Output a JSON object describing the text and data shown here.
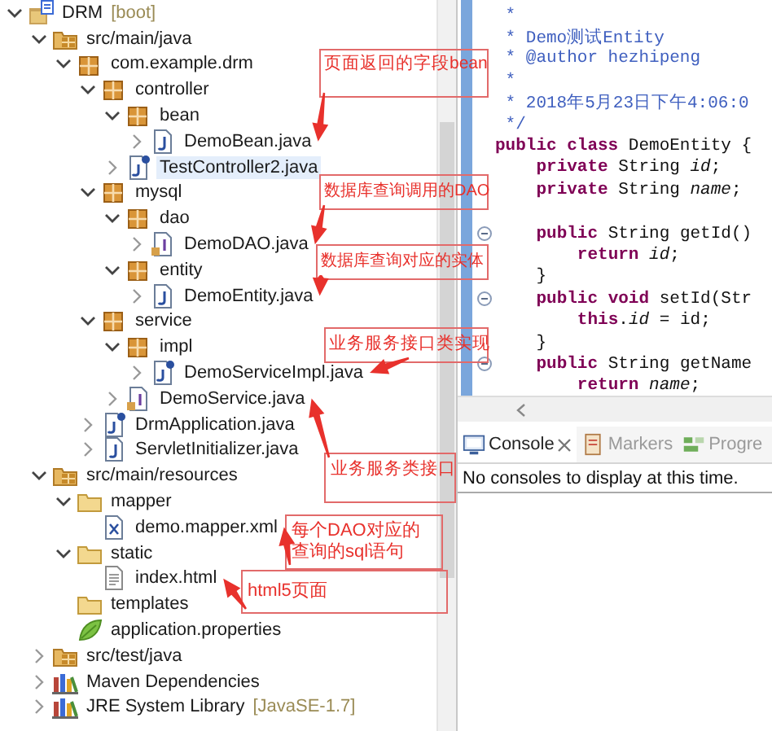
{
  "project_tree": {
    "items": [
      {
        "label": "DRM",
        "decoration": "[boot]",
        "kind": "project",
        "expandable": true,
        "expanded": true,
        "selected": false,
        "children": [
          {
            "label": "src/main/java",
            "kind": "source-folder",
            "expandable": true,
            "expanded": true,
            "selected": false,
            "children": [
              {
                "label": "com.example.drm",
                "kind": "package",
                "expandable": true,
                "expanded": true,
                "selected": false,
                "children": [
                  {
                    "label": "controller",
                    "kind": "package",
                    "expandable": true,
                    "expanded": true,
                    "selected": false,
                    "children": [
                      {
                        "label": "bean",
                        "kind": "package",
                        "expandable": true,
                        "expanded": true,
                        "selected": false,
                        "children": [
                          {
                            "label": "DemoBean.java",
                            "kind": "java",
                            "expandable": true,
                            "expanded": false,
                            "selected": false
                          }
                        ]
                      },
                      {
                        "label": "TestController2.java",
                        "kind": "java-spring",
                        "expandable": true,
                        "expanded": false,
                        "selected": true
                      }
                    ]
                  },
                  {
                    "label": "mysql",
                    "kind": "package",
                    "expandable": true,
                    "expanded": true,
                    "selected": false,
                    "children": [
                      {
                        "label": "dao",
                        "kind": "package",
                        "expandable": true,
                        "expanded": true,
                        "selected": false,
                        "children": [
                          {
                            "label": "DemoDAO.java",
                            "kind": "java-interface",
                            "expandable": true,
                            "expanded": false,
                            "selected": false
                          }
                        ]
                      },
                      {
                        "label": "entity",
                        "kind": "package",
                        "expandable": true,
                        "expanded": true,
                        "selected": false,
                        "children": [
                          {
                            "label": "DemoEntity.java",
                            "kind": "java",
                            "expandable": true,
                            "expanded": false,
                            "selected": false
                          }
                        ]
                      }
                    ]
                  },
                  {
                    "label": "service",
                    "kind": "package",
                    "expandable": true,
                    "expanded": true,
                    "selected": false,
                    "children": [
                      {
                        "label": "impl",
                        "kind": "package",
                        "expandable": true,
                        "expanded": true,
                        "selected": false,
                        "children": [
                          {
                            "label": "DemoServiceImpl.java",
                            "kind": "java-spring",
                            "expandable": true,
                            "expanded": false,
                            "selected": false
                          }
                        ]
                      },
                      {
                        "label": "DemoService.java",
                        "kind": "java-interface",
                        "expandable": true,
                        "expanded": false,
                        "selected": false
                      }
                    ]
                  },
                  {
                    "label": "DrmApplication.java",
                    "kind": "java-spring",
                    "expandable": true,
                    "expanded": false,
                    "selected": false
                  },
                  {
                    "label": "ServletInitializer.java",
                    "kind": "java",
                    "expandable": true,
                    "expanded": false,
                    "selected": false
                  }
                ]
              }
            ]
          },
          {
            "label": "src/main/resources",
            "kind": "source-folder",
            "expandable": true,
            "expanded": true,
            "selected": false,
            "children": [
              {
                "label": "mapper",
                "kind": "folder",
                "expandable": true,
                "expanded": true,
                "selected": false,
                "children": [
                  {
                    "label": "demo.mapper.xml",
                    "kind": "xml",
                    "expandable": false,
                    "selected": false
                  }
                ]
              },
              {
                "label": "static",
                "kind": "folder",
                "expandable": true,
                "expanded": true,
                "selected": false,
                "children": [
                  {
                    "label": "index.html",
                    "kind": "html",
                    "expandable": false,
                    "selected": false
                  }
                ]
              },
              {
                "label": "templates",
                "kind": "folder",
                "expandable": false,
                "selected": false
              },
              {
                "label": "application.properties",
                "kind": "properties",
                "expandable": false,
                "selected": false
              }
            ]
          },
          {
            "label": "src/test/java",
            "kind": "source-folder",
            "expandable": true,
            "expanded": false,
            "selected": false
          },
          {
            "label": "Maven Dependencies",
            "kind": "library",
            "expandable": true,
            "expanded": false,
            "selected": false
          },
          {
            "label": "JRE System Library",
            "decoration": "[JavaSE-1.7]",
            "kind": "library",
            "expandable": true,
            "expanded": false,
            "selected": false
          }
        ]
      }
    ]
  },
  "editor": {
    "lines": [
      {
        "text": " *",
        "fold": false
      },
      {
        "text": " * Demo测试Entity",
        "fold": false
      },
      {
        "text": " * @author hezhipeng",
        "fold": false
      },
      {
        "text": " *",
        "fold": false
      },
      {
        "text": " * 2018年5月23日下午4:06:0",
        "fold": false
      },
      {
        "text": " */",
        "fold": false
      },
      {
        "text": "**public class** DemoEntity {",
        "fold": false
      },
      {
        "text": "    **private** String *id*;",
        "fold": false
      },
      {
        "text": "    **private** String *name*;",
        "fold": false
      },
      {
        "fold": false
      },
      {
        "text": "    **public** String getId()",
        "fold": true
      },
      {
        "text": "        **return** *id*;",
        "fold": false
      },
      {
        "text": "    }",
        "fold": false
      },
      {
        "text": "    **public void** setId(Str",
        "fold": true
      },
      {
        "text": "        **this**.*id* = id;",
        "fold": false
      },
      {
        "text": "    }",
        "fold": false
      },
      {
        "text": "    **public** String getName",
        "fold": true
      },
      {
        "text": "        **return** *name*;",
        "fold": false
      }
    ]
  },
  "console": {
    "tabs": [
      {
        "label": "Console",
        "kind": "console",
        "selected": true,
        "closable": true
      },
      {
        "label": "Markers",
        "kind": "markers",
        "selected": false,
        "closable": false
      },
      {
        "label": "Progre",
        "kind": "progress",
        "selected": false,
        "closable": false
      }
    ],
    "message": "No consoles to display at this time."
  },
  "annotations": [
    {
      "text": "页面返回的字段bean"
    },
    {
      "text": "数据库查询调用的DAO"
    },
    {
      "text": "数据库查询对应的实体"
    },
    {
      "text": "业务服务接口类实现"
    },
    {
      "text": "业务服务类接口"
    },
    {
      "text": "每个DAO对应的查询的sql语句"
    },
    {
      "text": "html5页面"
    }
  ]
}
